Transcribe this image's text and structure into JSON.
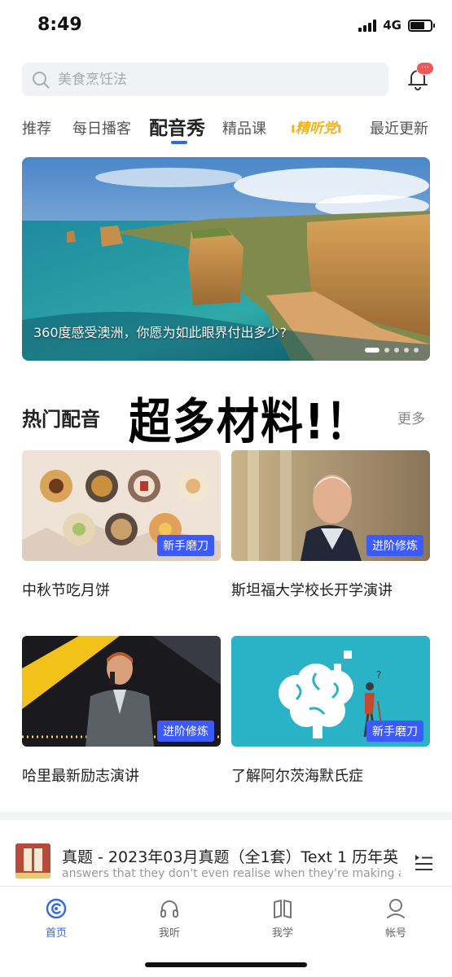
{
  "status_bar": {
    "time": "8:49",
    "network": "4G"
  },
  "search": {
    "placeholder": "美食烹饪法",
    "icon": "search-icon"
  },
  "notification": {
    "icon": "bell-icon",
    "badge": "···"
  },
  "tabs": [
    {
      "label": "推荐",
      "active": false
    },
    {
      "label": "每日播客",
      "active": false
    },
    {
      "label": "配音秀",
      "active": true
    },
    {
      "label": "精品课",
      "active": false
    },
    {
      "label": "精听党",
      "active": false,
      "style": "brand"
    },
    {
      "label": "最近更新",
      "active": false
    }
  ],
  "colors": {
    "accent": "#2f6ae8",
    "tag": "#3d5afe",
    "brand_yellow": "#f3b21a",
    "badge_red": "#f25757"
  },
  "banner": {
    "caption": "360度感受澳洲，你愿为如此眼界付出多少?",
    "slide_count": 5,
    "active_slide": 1
  },
  "section": {
    "title": "热门配音",
    "overlay": "超多材料!！",
    "more": "更多"
  },
  "cards": [
    {
      "title": "中秋节吃月饼",
      "tag": "新手磨刀"
    },
    {
      "title": "斯坦福大学校长开学演讲",
      "tag": "进阶修炼"
    },
    {
      "title": "哈里最新励志演讲",
      "tag": "进阶修炼"
    },
    {
      "title": "了解阿尔茨海默氏症",
      "tag": "新手磨刀"
    }
  ],
  "mini_player": {
    "title": "真题 - 2023年03月真题（全1套）Text 1  历年英",
    "subtitle": "answers that they don't even realise when they're making a",
    "icon": "playlist-icon"
  },
  "bottom_nav": [
    {
      "label": "首页",
      "icon": "home-icon",
      "active": true
    },
    {
      "label": "我听",
      "icon": "headphones-icon",
      "active": false
    },
    {
      "label": "我学",
      "icon": "book-icon",
      "active": false
    },
    {
      "label": "帐号",
      "icon": "user-icon",
      "active": false
    }
  ]
}
